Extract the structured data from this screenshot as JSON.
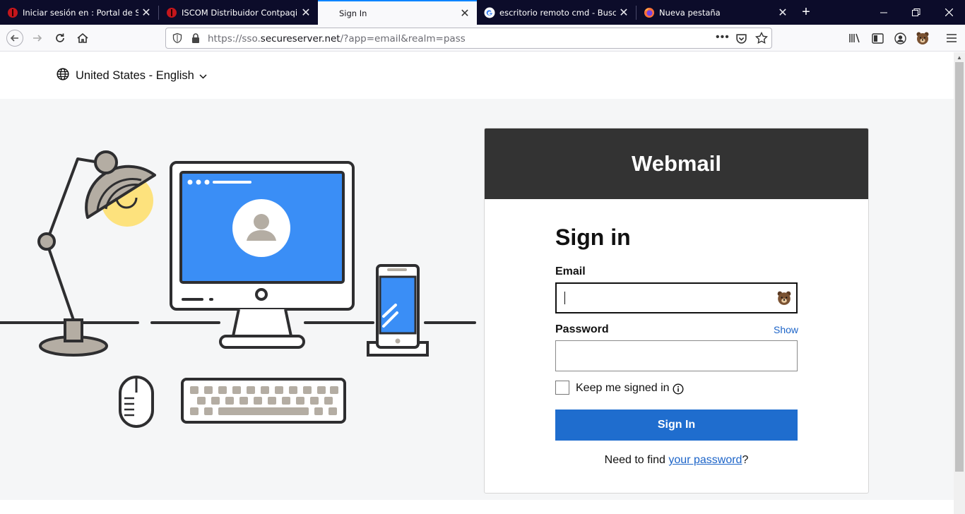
{
  "browser": {
    "tabs": [
      {
        "label": "Iniciar sesión en : Portal de Sop",
        "icon": "red-shield-icon"
      },
      {
        "label": "ISCOM Distribuidor Contpaqi",
        "icon": "red-shield-icon"
      },
      {
        "label": "Sign In",
        "icon": "none"
      },
      {
        "label": "escritorio remoto cmd - Buscar",
        "icon": "google-icon"
      },
      {
        "label": "Nueva pestaña",
        "icon": "firefox-icon"
      }
    ],
    "active_tab_index": 2,
    "url": {
      "prefix": "https://sso.",
      "host": "secureserver.net",
      "path": "/?app=email&realm=pass"
    },
    "colors": {
      "tabstrip": "#0c0c2a",
      "active_tab_accent": "#0a84ff"
    }
  },
  "page": {
    "locale_label": "United States - English",
    "card": {
      "header": "Webmail",
      "title": "Sign in",
      "email_label": "Email",
      "email_value": "",
      "password_label": "Password",
      "password_value": "",
      "show_label": "Show",
      "keep_signed_in_label": "Keep me signed in",
      "keep_signed_in_checked": false,
      "submit_label": "Sign In",
      "help_prefix": "Need to find ",
      "help_link": "your password",
      "help_suffix": "?"
    },
    "colors": {
      "primary_button": "#1f6dce",
      "card_header": "#333333",
      "link": "#1c64c8",
      "monitor_screen": "#3a8ef6"
    }
  }
}
